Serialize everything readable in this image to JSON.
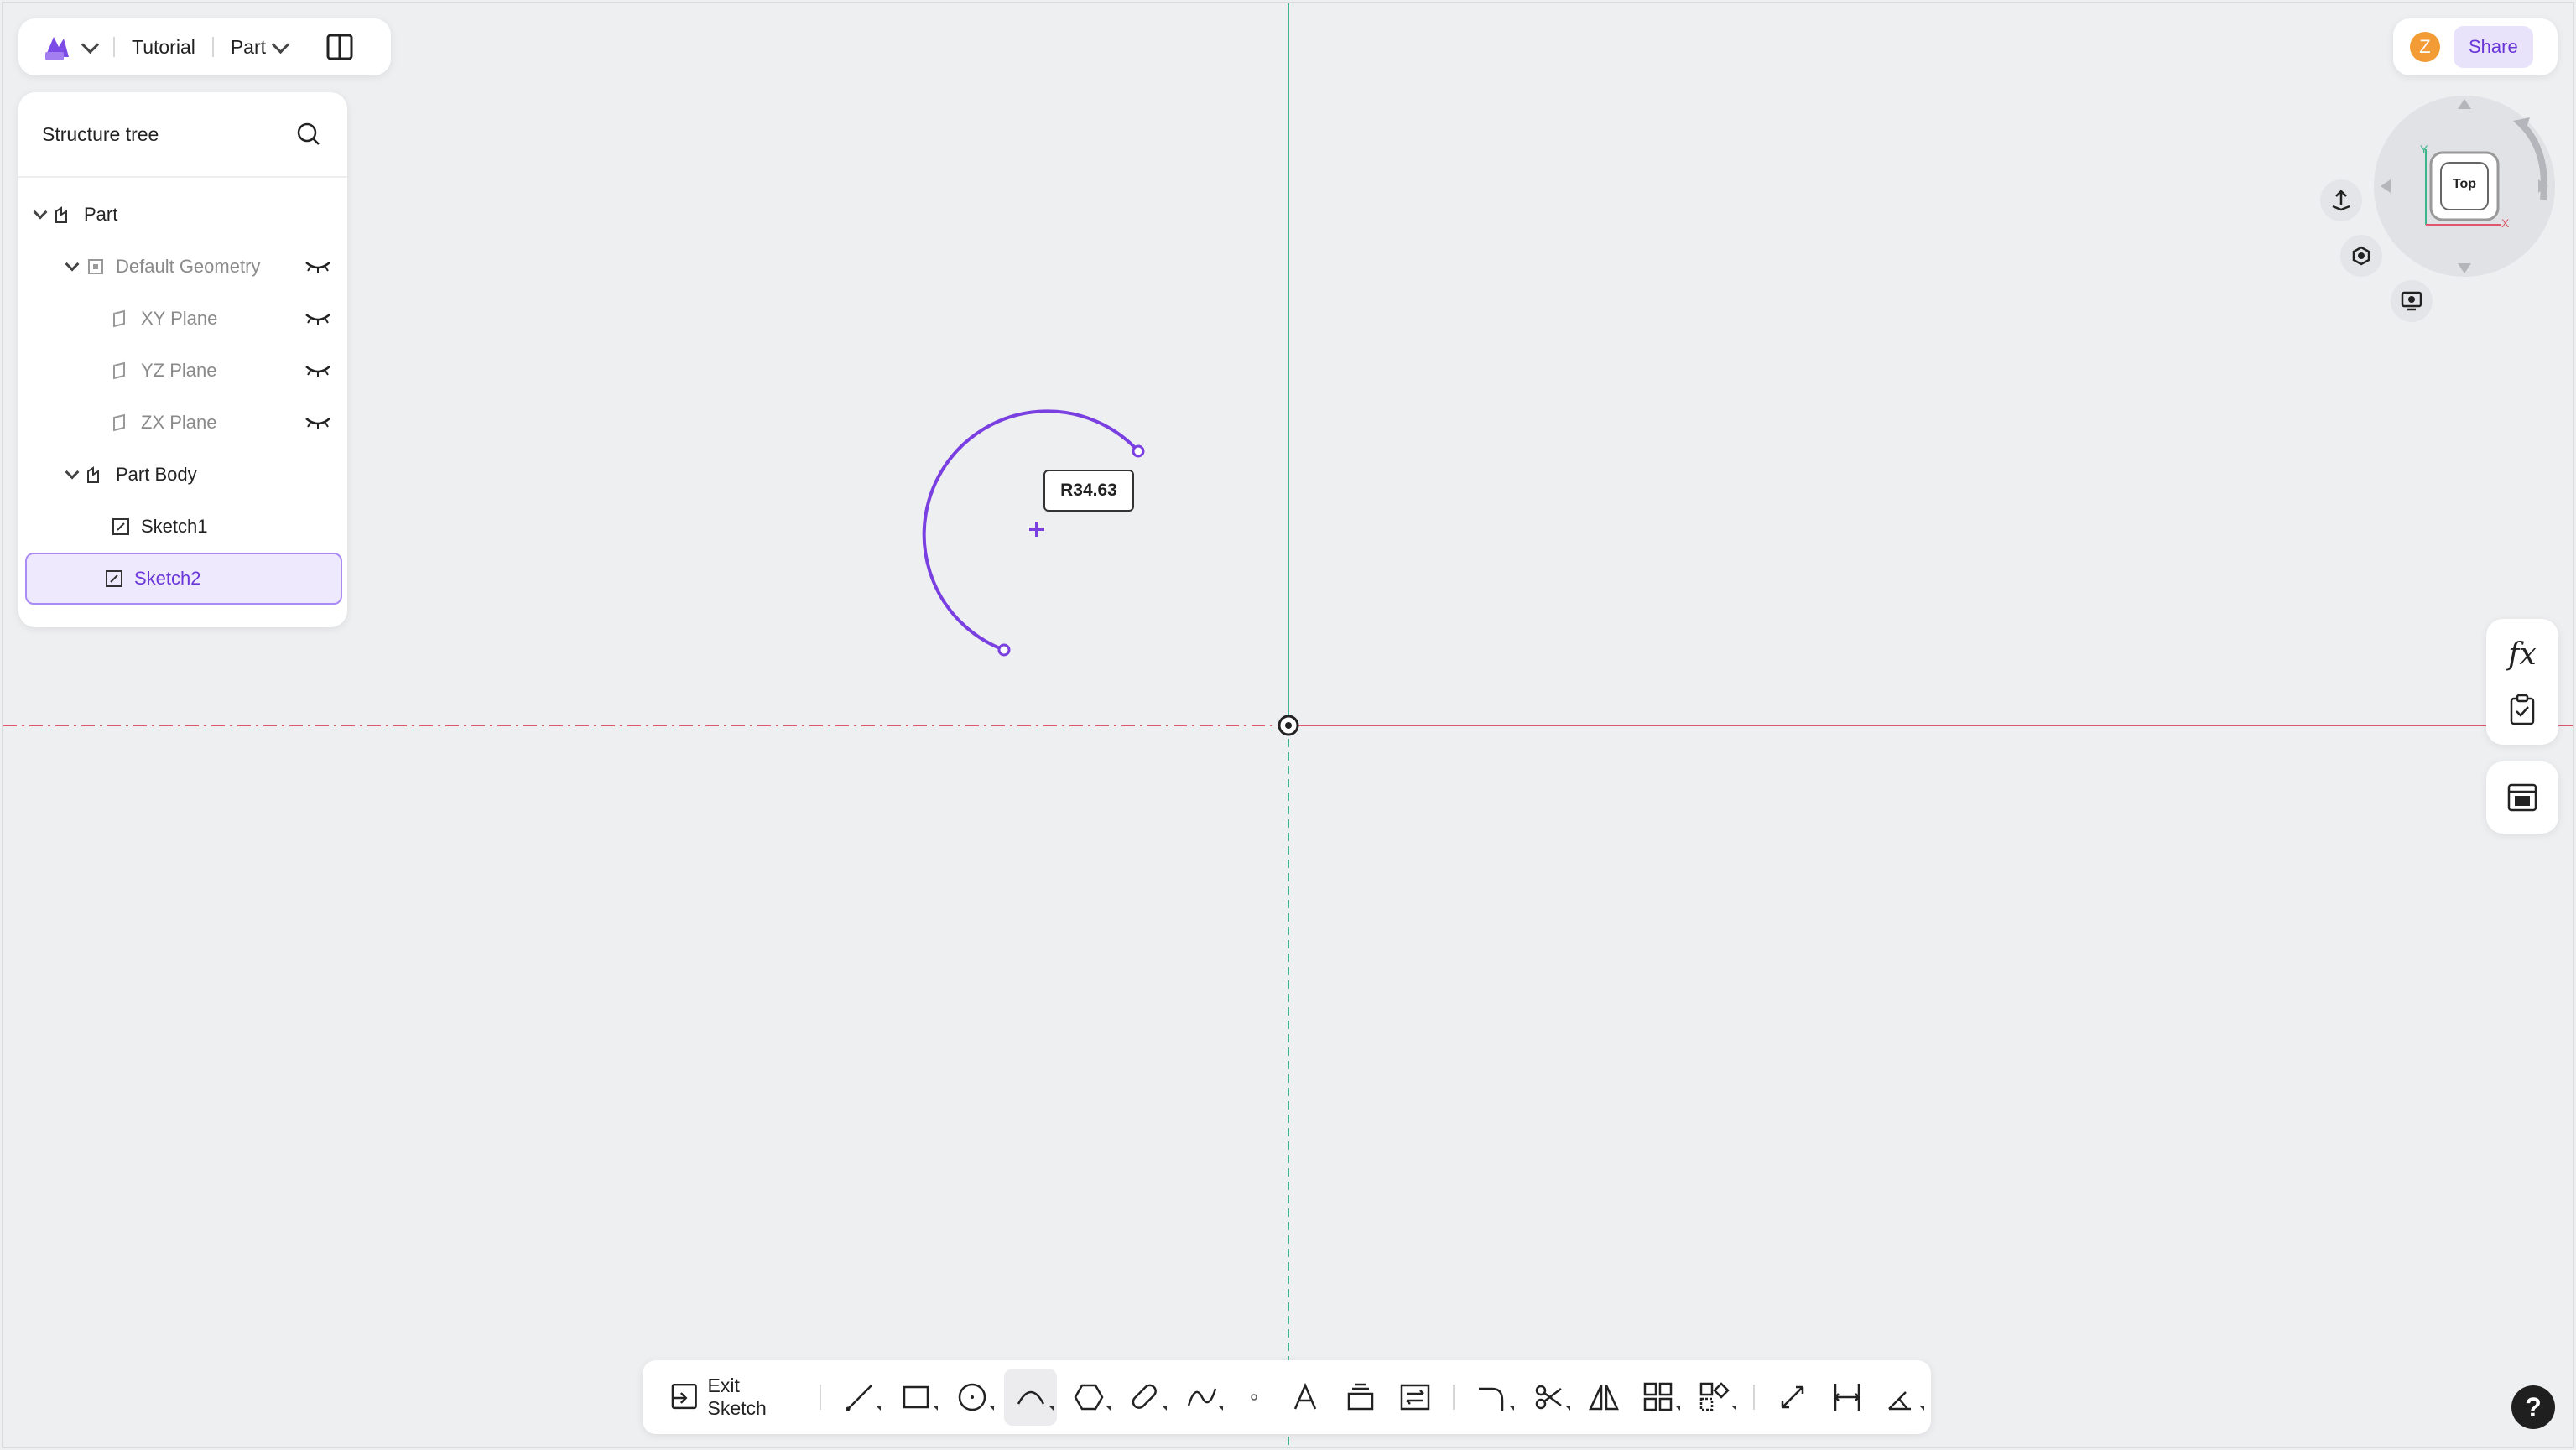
{
  "app": {
    "project_name": "Tutorial",
    "mode": "Part"
  },
  "user": {
    "avatar_letter": "Z",
    "share_label": "Share"
  },
  "tree": {
    "title": "Structure tree",
    "items": [
      {
        "label": "Part"
      },
      {
        "label": "Default Geometry"
      },
      {
        "label": "XY Plane"
      },
      {
        "label": "YZ Plane"
      },
      {
        "label": "ZX Plane"
      },
      {
        "label": "Part Body"
      },
      {
        "label": "Sketch1"
      },
      {
        "label": "Sketch2"
      }
    ]
  },
  "viewcube": {
    "face_label": "Top",
    "axis_y": "Y",
    "axis_x": "X"
  },
  "sketch": {
    "radius_dimension": "R34.63"
  },
  "toolbar": {
    "exit_label": "Exit Sketch"
  },
  "side_tools": {
    "formula_label": "fx"
  },
  "help": {
    "label": "?"
  },
  "colors": {
    "accent": "#6a36d9",
    "arc": "#7a3fe0",
    "x_axis": "#e0566b",
    "y_axis": "#3bb58a",
    "background": "#eeeff1"
  }
}
